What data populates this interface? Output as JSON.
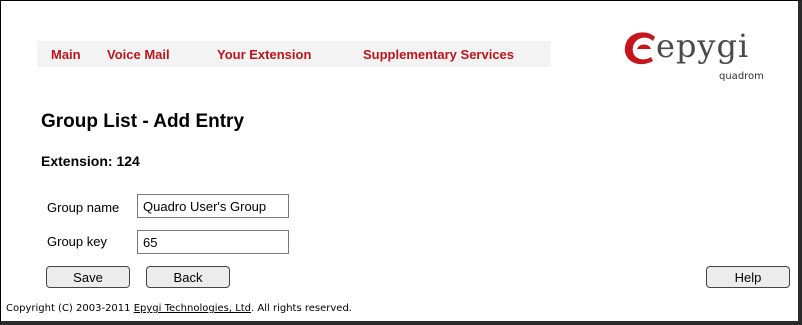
{
  "menu": {
    "items": [
      {
        "label": "Main"
      },
      {
        "label": "Voice Mail"
      },
      {
        "label": "Your Extension"
      },
      {
        "label": "Supplementary Services"
      }
    ],
    "link_color": "#b8151c"
  },
  "logo": {
    "brand": "epygi",
    "product": "quadrom"
  },
  "page": {
    "title": "Group List - Add Entry",
    "extension_label": "Extension: 124"
  },
  "form": {
    "group_name_label": "Group name",
    "group_name_value": "Quadro User's Group",
    "group_key_label": "Group key",
    "group_key_value": "65"
  },
  "buttons": {
    "save": "Save",
    "back": "Back",
    "help": "Help"
  },
  "footer": {
    "prefix": "Copyright (C) 2003-2011 ",
    "company_link": "Epygi Technologies, Ltd",
    "suffix": ". All rights reserved."
  }
}
